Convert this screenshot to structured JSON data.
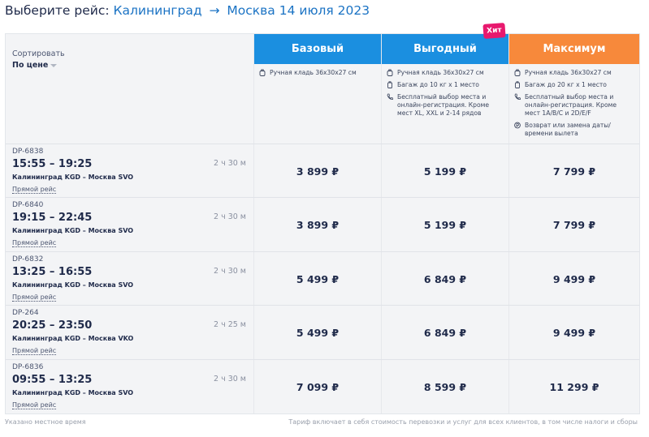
{
  "header": {
    "title_prefix": "Выберите рейс:",
    "origin": "Калининград",
    "arrow": "→",
    "destination": "Москва",
    "date": "14 июля 2023"
  },
  "sort": {
    "label": "Сортировать",
    "value": "По цене"
  },
  "fares": [
    {
      "name": "Базовый",
      "color": "#1b8fe0",
      "features": [
        {
          "icon": "bag-icon",
          "text": "Ручная кладь 36x30x27 см"
        }
      ]
    },
    {
      "name": "Выгодный",
      "color": "#1b8fe0",
      "badge": "Хит",
      "features": [
        {
          "icon": "bag-icon",
          "text": "Ручная кладь 36x30x27 см"
        },
        {
          "icon": "suitcase-icon",
          "text": "Багаж до 10 кг x 1 место"
        },
        {
          "icon": "phone-icon",
          "text": "Бесплатный выбор места и онлайн-регистрация. Кроме мест XL, XXL и 2-14 рядов"
        }
      ]
    },
    {
      "name": "Максимум",
      "color": "#f7893b",
      "features": [
        {
          "icon": "bag-icon",
          "text": "Ручная кладь 36x30x27 см"
        },
        {
          "icon": "suitcase-icon",
          "text": "Багаж до 20 кг x 1 место"
        },
        {
          "icon": "phone-icon",
          "text": "Бесплатный выбор места и онлайн-регистрация. Кроме мест 1A/B/C и 2D/E/F"
        },
        {
          "icon": "refund-icon",
          "text": "Возврат или замена даты/времени вылета"
        }
      ]
    }
  ],
  "flights": [
    {
      "number": "DP-6838",
      "time": "15:55 – 19:25",
      "route": "Калининград KGD – Москва SVO",
      "duration": "2 ч 30 м",
      "type": "Прямой рейс",
      "prices": [
        "3 899 ₽",
        "5 199 ₽",
        "7 799 ₽"
      ]
    },
    {
      "number": "DP-6840",
      "time": "19:15 – 22:45",
      "route": "Калининград KGD – Москва SVO",
      "duration": "2 ч 30 м",
      "type": "Прямой рейс",
      "prices": [
        "3 899 ₽",
        "5 199 ₽",
        "7 799 ₽"
      ]
    },
    {
      "number": "DP-6832",
      "time": "13:25 – 16:55",
      "route": "Калининград KGD – Москва SVO",
      "duration": "2 ч 30 м",
      "type": "Прямой рейс",
      "prices": [
        "5 499 ₽",
        "6 849 ₽",
        "9 499 ₽"
      ]
    },
    {
      "number": "DP-264",
      "time": "20:25 – 23:50",
      "route": "Калининград KGD – Москва VKO",
      "duration": "2 ч 25 м",
      "type": "Прямой рейс",
      "prices": [
        "5 499 ₽",
        "6 849 ₽",
        "9 499 ₽"
      ]
    },
    {
      "number": "DP-6836",
      "time": "09:55 – 13:25",
      "route": "Калининград KGD – Москва SVO",
      "duration": "2 ч 30 м",
      "type": "Прямой рейс",
      "prices": [
        "7 099 ₽",
        "8 599 ₽",
        "11 299 ₽"
      ]
    }
  ],
  "footer": {
    "left": "Указано местное время",
    "right": "Тариф включает в себя стоимость перевозки и услуг для всех клиентов, в том числе налоги и сборы"
  }
}
